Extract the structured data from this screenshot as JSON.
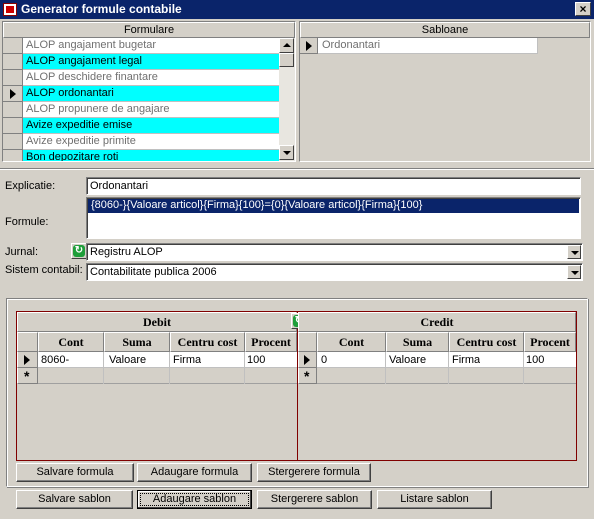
{
  "window": {
    "title": "Generator formule contabile",
    "close_label": "×"
  },
  "formulare": {
    "header": "Formulare",
    "items": [
      {
        "label": "ALOP angajament bugetar",
        "highlight": false,
        "current": false
      },
      {
        "label": "ALOP angajament legal",
        "highlight": true,
        "current": false
      },
      {
        "label": "ALOP deschidere finantare",
        "highlight": false,
        "current": false
      },
      {
        "label": "ALOP ordonantari",
        "highlight": true,
        "current": true
      },
      {
        "label": "ALOP propunere de angajare",
        "highlight": false,
        "current": false
      },
      {
        "label": "Avize expeditie emise",
        "highlight": true,
        "current": false
      },
      {
        "label": "Avize expeditie primite",
        "highlight": false,
        "current": false
      },
      {
        "label": "Bon depozitare roti",
        "highlight": true,
        "current": false
      }
    ]
  },
  "sabloane": {
    "header": "Sabloane",
    "items": [
      {
        "label": "Ordonantari"
      }
    ]
  },
  "form": {
    "explicatie_label": "Explicatie:",
    "explicatie_value": "Ordonantari",
    "formule_label": "Formule:",
    "formule_value": "{8060-}{Valoare articol}{Firma}{100}={0}{Valoare articol}{Firma}{100}",
    "jurnal_label": "Jurnal:",
    "jurnal_value": "Registru ALOP",
    "sistem_label": "Sistem contabil:",
    "sistem_value": "Contabilitate publica 2006"
  },
  "debit": {
    "title": "Debit",
    "columns": [
      "Cont",
      "Suma",
      "Centru cost",
      "Procent"
    ],
    "rows": [
      [
        "8060-",
        "Valoare",
        "Firma",
        "100"
      ]
    ],
    "new_row_marker": "*"
  },
  "credit": {
    "title": "Credit",
    "columns": [
      "Cont",
      "Suma",
      "Centru cost",
      "Procent"
    ],
    "rows": [
      [
        "0",
        "Valoare",
        "Firma",
        "100"
      ]
    ],
    "new_row_marker": "*"
  },
  "buttons": {
    "salvare_formula": "Salvare formula",
    "adaugare_formula": "Adaugare formula",
    "stergere_formula": "Stergerere formula",
    "salvare_sablon": "Salvare sablon",
    "adaugare_sablon": "Adaugare sablon",
    "stergere_sablon": "Stergerere sablon",
    "listare_sablon": "Listare sablon"
  },
  "colors": {
    "highlight": "#00ffff",
    "selection": "#0a246a",
    "titlebar": "#0a246a",
    "grid_border": "#800000",
    "refresh_icon": "#1e9e3a"
  },
  "icons": [
    "app-icon",
    "close-icon",
    "refresh-icon",
    "row-pointer-icon",
    "new-row-icon",
    "scroll-up-icon",
    "scroll-down-icon",
    "dropdown-arrow-icon"
  ]
}
